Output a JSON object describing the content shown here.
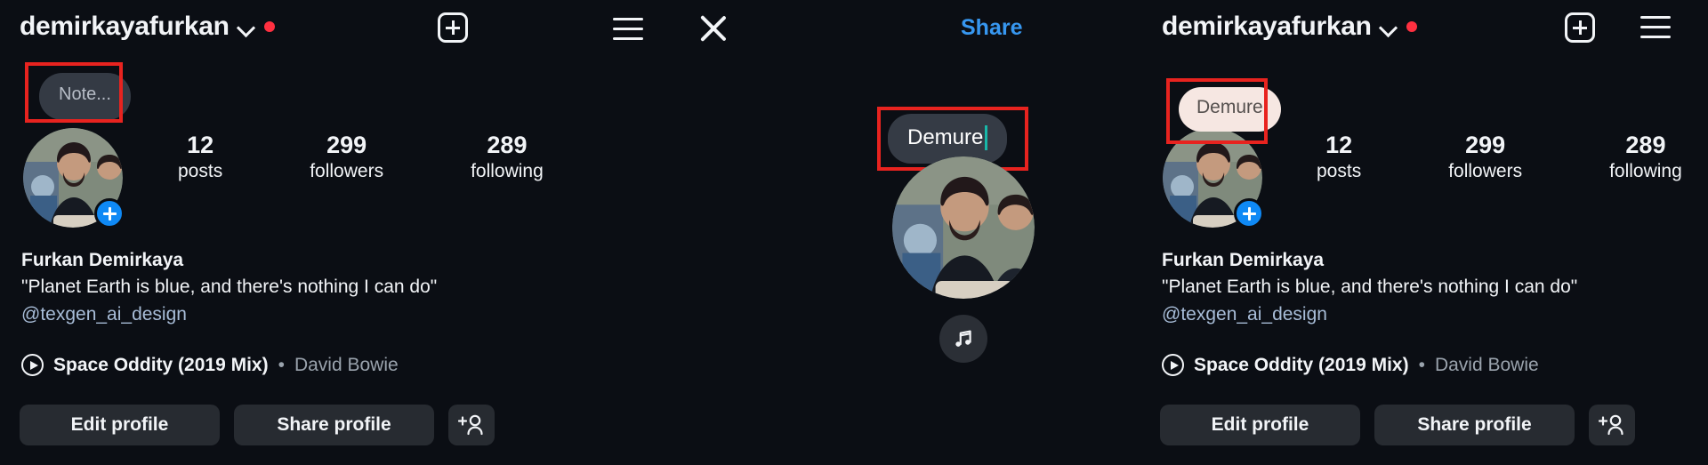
{
  "app": "instagram-profile",
  "colors": {
    "background": "#0b0e14",
    "accent_blue": "#3797f0",
    "badge_blue": "#0f89f5",
    "red_dot": "#ff3040",
    "annotation_red": "#e8231f",
    "button_gray": "#272b31",
    "note_dark": "#343a44",
    "note_light": "#f6e7e2",
    "caret_teal": "#18b7a8",
    "handle_blue": "#a8bdd8"
  },
  "profile": {
    "username": "demirkayafurkan",
    "display_name": "Furkan Demirkaya",
    "bio_line": "\"Planet Earth is blue, and there's nothing I can do\"",
    "bio_handle": "@texgen_ai_design",
    "stats": [
      {
        "number": "12",
        "label": "posts"
      },
      {
        "number": "299",
        "label": "followers"
      },
      {
        "number": "289",
        "label": "following"
      }
    ],
    "music": {
      "title": "Space Oddity (2019 Mix)",
      "separator": "•",
      "artist": "David Bowie"
    },
    "actions": {
      "edit_profile": "Edit profile",
      "share_profile": "Share profile",
      "add_person_icon": "add-person-icon"
    }
  },
  "panels": [
    {
      "id": "panel-before",
      "header": {
        "username": "demirkayafurkan",
        "chevron_icon": "chevron-down-icon",
        "activity_dot": "red-dot-indicator",
        "new_post_icon": "plus-square-icon"
      },
      "note": {
        "text": "Note...",
        "style": "placeholder"
      }
    },
    {
      "id": "panel-editing",
      "header": {
        "menu_icon": "hamburger-menu-icon",
        "close_icon": "close-x-icon",
        "share_label": "Share"
      },
      "note": {
        "text": "Demure",
        "style": "editing",
        "caret": true
      },
      "music_button_icon": "music-note-icon"
    },
    {
      "id": "panel-after",
      "header": {
        "username": "demirkayafurkan",
        "chevron_icon": "chevron-down-icon",
        "activity_dot": "red-dot-indicator",
        "new_post_icon": "plus-square-icon",
        "menu_icon": "hamburger-menu-icon"
      },
      "note": {
        "text": "Demure",
        "style": "posted"
      }
    }
  ]
}
